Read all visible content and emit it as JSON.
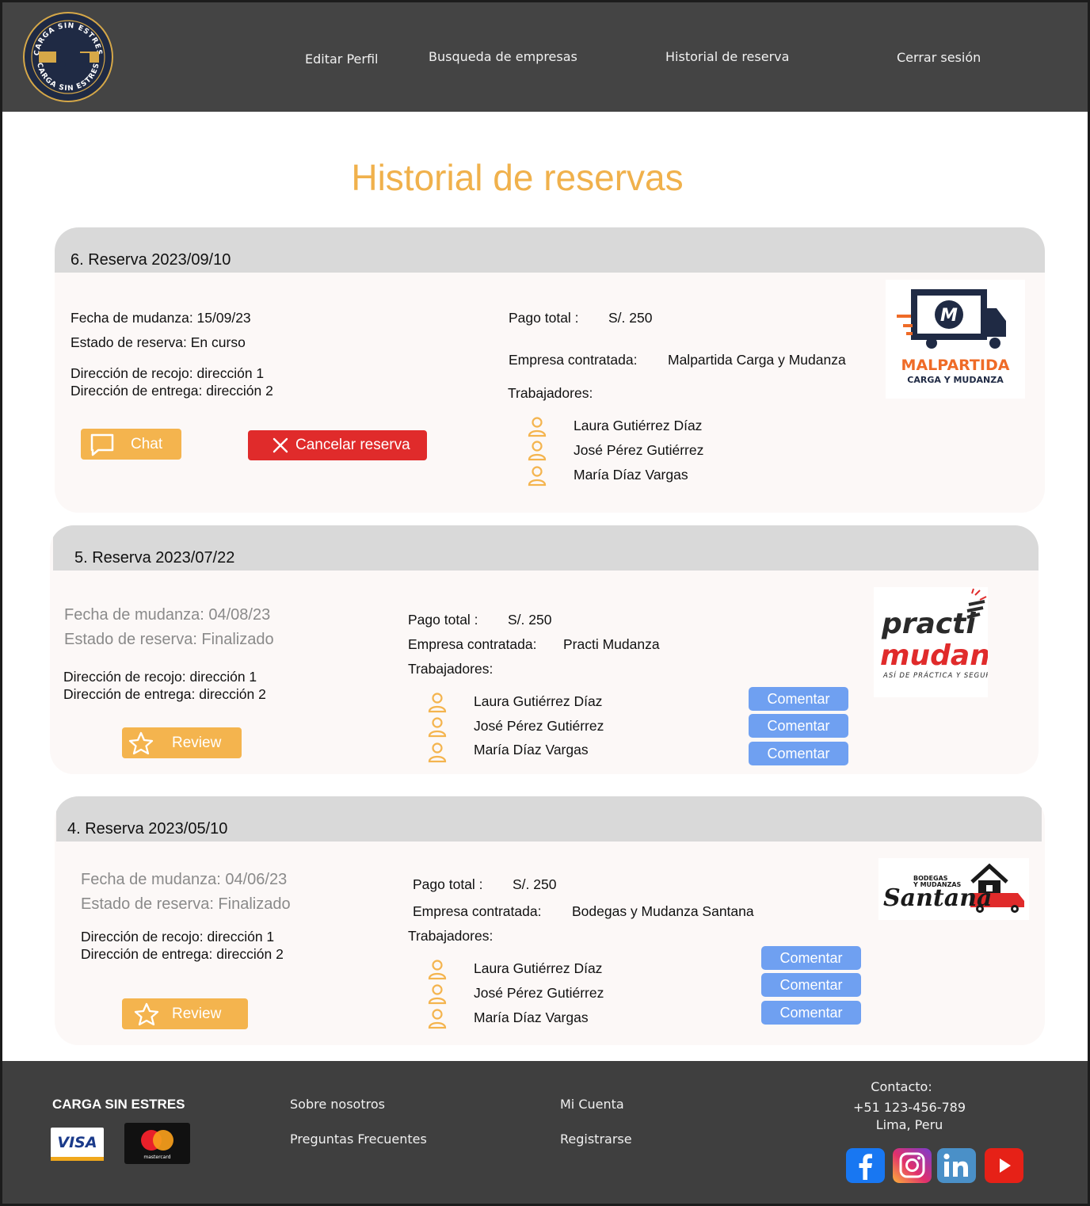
{
  "brand": {
    "logo_ring_text": "CARGA SIN ESTRES",
    "colors": {
      "header": "#444444",
      "accent": "#f0b14c",
      "danger": "#e02b2b",
      "comment": "#6fa0f1"
    }
  },
  "nav": {
    "edit_profile": "Editar Perfil",
    "search": "Busqueda de empresas",
    "history": "Historial de reserva",
    "logout": "Cerrar sesión"
  },
  "page": {
    "title": "Historial de reservas"
  },
  "labels": {
    "pago_total": "Pago total :",
    "empresa": "Empresa contratada:",
    "trabajadores": "Trabajadores:",
    "comentar": "Comentar"
  },
  "reservations": [
    {
      "title": "6. Reserva 2023/09/10",
      "fecha": "Fecha de mudanza: 15/09/23",
      "estado": "Estado de reserva: En curso",
      "recojo": "Dirección de recojo: dirección 1",
      "entrega": "Dirección de entrega: dirección 2",
      "pago": "S/. 250",
      "empresa": "Malpartida Carga y Mudanza",
      "workers": [
        "Laura Gutiérrez Díaz",
        "José Pérez Gutiérrez",
        " María Díaz Vargas"
      ],
      "chat_label": "Chat",
      "cancel_label": "Cancelar reserva",
      "logo": {
        "line1": "MALPARTIDA",
        "line2": "CARGA Y MUDANZA",
        "mark": "M"
      }
    },
    {
      "title": "5. Reserva 2023/07/22",
      "fecha": "Fecha de mudanza: 04/08/23",
      "estado": "Estado de reserva: Finalizado",
      "recojo": "Dirección de recojo: dirección 1",
      "entrega": "Dirección de entrega: dirección 2",
      "pago": "S/. 250",
      "empresa": "Practi Mudanza",
      "workers": [
        "Laura Gutiérrez Díaz",
        "José Pérez Gutiérrez",
        "María Díaz Vargas"
      ],
      "review_label": "Review",
      "logo": {
        "line1": "practi",
        "line2": "mudanza",
        "line3": "ASÍ DE PRÁCTICA Y SEGURA"
      }
    },
    {
      "title": "4. Reserva 2023/05/10",
      "fecha": "Fecha de mudanza: 04/06/23",
      "estado": "Estado de reserva: Finalizado",
      "recojo": "Dirección de recojo: dirección 1",
      "entrega": "Dirección de entrega: dirección 2",
      "pago": "S/. 250",
      "empresa": "Bodegas y Mudanza Santana",
      "workers": [
        "Laura Gutiérrez Díaz",
        "José Pérez Gutiérrez",
        "María Díaz Vargas"
      ],
      "review_label": "Review",
      "logo": {
        "line1": "BODEGAS",
        "line2": "Y MUDANZAS",
        "line3": "Santana"
      }
    }
  ],
  "footer": {
    "brand": "CARGA SIN ESTRES",
    "about": "Sobre nosotros",
    "faq": "Preguntas Frecuentes",
    "account": "Mi Cuenta",
    "register": "Registrarse",
    "contact_title": "Contacto:",
    "phone": "+51 123-456-789",
    "city": "Lima, Peru",
    "visa": "VISA",
    "mastercard": "mastercard",
    "social": [
      "facebook",
      "instagram",
      "linkedin",
      "youtube"
    ]
  }
}
